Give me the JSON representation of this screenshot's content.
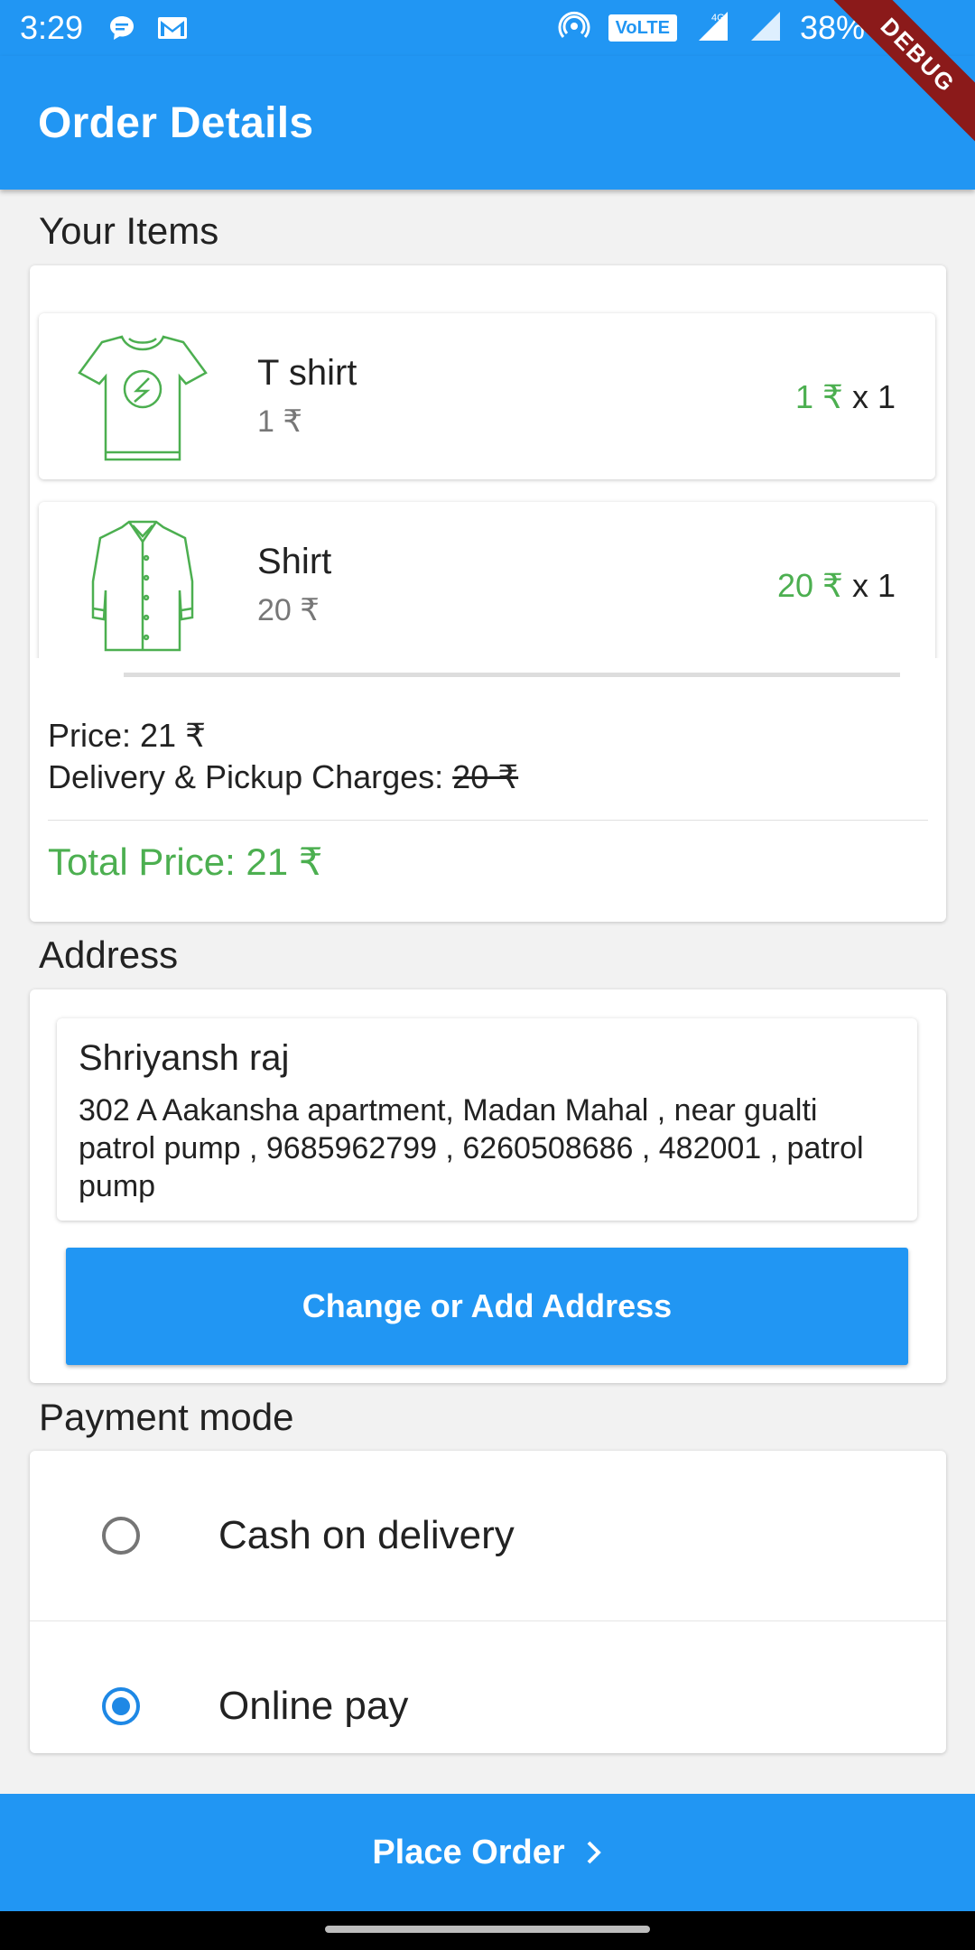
{
  "status_bar": {
    "time": "3:29",
    "network": "VoLTE",
    "signal_label": "4G",
    "battery": "38%"
  },
  "app_bar": {
    "title": "Order Details"
  },
  "debug_banner": "DEBUG",
  "items_section": {
    "title": "Your Items",
    "items": [
      {
        "name": "T shirt",
        "unit_price": "1 ₹",
        "line_price": "1 ₹",
        "qty": "x 1",
        "icon": "tshirt-icon"
      },
      {
        "name": "Shirt",
        "unit_price": "20 ₹",
        "line_price": "20 ₹",
        "qty": "x 1",
        "icon": "shirt-icon"
      }
    ],
    "price_line": "Price: 21 ₹",
    "delivery_label": "Delivery & Pickup Charges: ",
    "delivery_value": "20 ₹",
    "total": "Total Price: 21 ₹"
  },
  "address_section": {
    "title": "Address",
    "name": "Shriyansh raj",
    "address": "302 A Aakansha apartment, Madan Mahal , near gualti patrol pump , 9685962799  , 6260508686  , 482001 , patrol pump",
    "button_label": "Change or Add Address"
  },
  "payment_section": {
    "title": "Payment mode",
    "options": [
      {
        "label": "Cash on delivery",
        "selected": false
      },
      {
        "label": "Online pay",
        "selected": true
      }
    ]
  },
  "place_order": {
    "label": "Place Order"
  },
  "colors": {
    "primary": "#2196f3",
    "accent_green": "#4caf50",
    "radio_selected": "#1e88e5"
  }
}
